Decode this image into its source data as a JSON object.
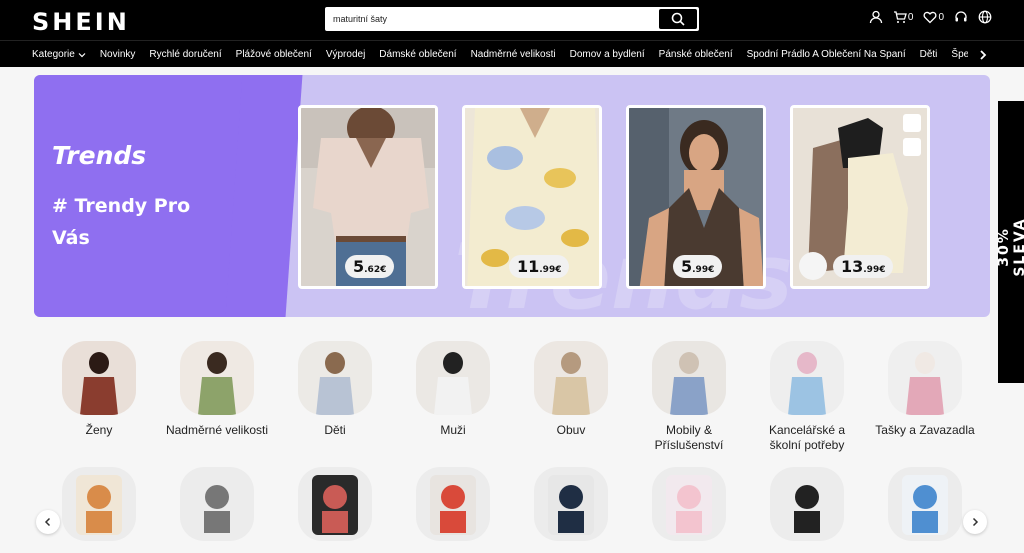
{
  "header": {
    "logo": "SHEIN",
    "search_value": "maturitní šaty",
    "cart_count": "0",
    "wishlist_count": "0"
  },
  "nav": {
    "items": [
      "Kategorie",
      "Novinky",
      "Rychlé doručení",
      "Plážové oblečení",
      "Výprodej",
      "Dámské oblečení",
      "Nadměrné velikosti",
      "Domov a bydlení",
      "Pánské oblečení",
      "Spodní Prádlo A Oblečení Na Spaní",
      "Děti",
      "Šperky A"
    ]
  },
  "banner": {
    "logo_text": "Trends",
    "title": "# Trendy Pro Vás",
    "watermark": "Trends",
    "cards": [
      {
        "price_main": "5",
        "price_dec": ".62€"
      },
      {
        "price_main": "11",
        "price_dec": ".99€"
      },
      {
        "price_main": "5",
        "price_dec": ".99€"
      },
      {
        "price_main": "13",
        "price_dec": ".99€"
      }
    ]
  },
  "side_promo": "30% SLEVA",
  "categories": {
    "row1": [
      "Ženy",
      "Nadměrné velikosti",
      "Děti",
      "Muži",
      "Obuv",
      "Mobily & Příslušenství",
      "Kancelářské a školní potřeby",
      "Tašky a Zavazadla"
    ]
  }
}
